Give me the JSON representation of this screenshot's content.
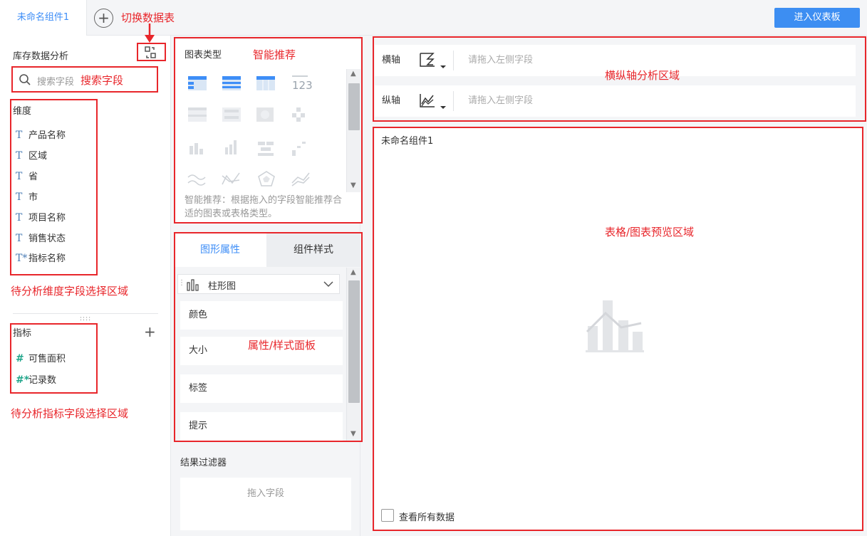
{
  "topbar": {
    "tab_label": "未命名组件1",
    "add_tab_symbol": "+",
    "enter_dashboard_label": "进入仪表板"
  },
  "left": {
    "table_name": "库存数据分析",
    "search_placeholder": "搜索字段",
    "dimension_title": "维度",
    "dimensions": [
      "产品名称",
      "区域",
      "省",
      "市",
      "项目名称",
      "销售状态",
      "指标名称"
    ],
    "dimension_icons": [
      "T",
      "T",
      "T",
      "T",
      "T",
      "T",
      "T*"
    ],
    "measure_title": "指标",
    "measures": [
      "可售面积",
      "记录数"
    ],
    "measure_icons": [
      "#",
      "#*"
    ],
    "add_symbol": "+"
  },
  "mid": {
    "chart_type_title": "图表类型",
    "hint": "智能推荐：根据拖入的字段智能推荐合适的图表或表格类型。",
    "tabs": [
      "图形属性",
      "组件样式"
    ],
    "chart_select": "柱形图",
    "props": [
      "颜色",
      "大小",
      "标签",
      "提示"
    ],
    "filter_title": "结果过滤器",
    "filter_placeholder": "拖入字段"
  },
  "right": {
    "x_axis_label": "横轴",
    "y_axis_label": "纵轴",
    "x_placeholder": "请拖入左侧字段",
    "y_placeholder": "请拖入左侧字段",
    "preview_title": "未命名组件1",
    "view_all_label": "查看所有数据"
  },
  "annotations": {
    "switch_table": "切换数据表",
    "search_field": "搜索字段",
    "smart_recommend": "智能推荐",
    "axis_area": "横纵轴分析区域",
    "preview_area": "表格/图表预览区域",
    "dimension_area": "待分析维度字段选择区域",
    "measure_area": "待分析指标字段选择区域",
    "prop_panel": "属性/样式面板"
  },
  "colors": {
    "accent": "#3e8ef7",
    "annotation_red": "#e8262b",
    "panel_bg": "#f4f5f7"
  }
}
